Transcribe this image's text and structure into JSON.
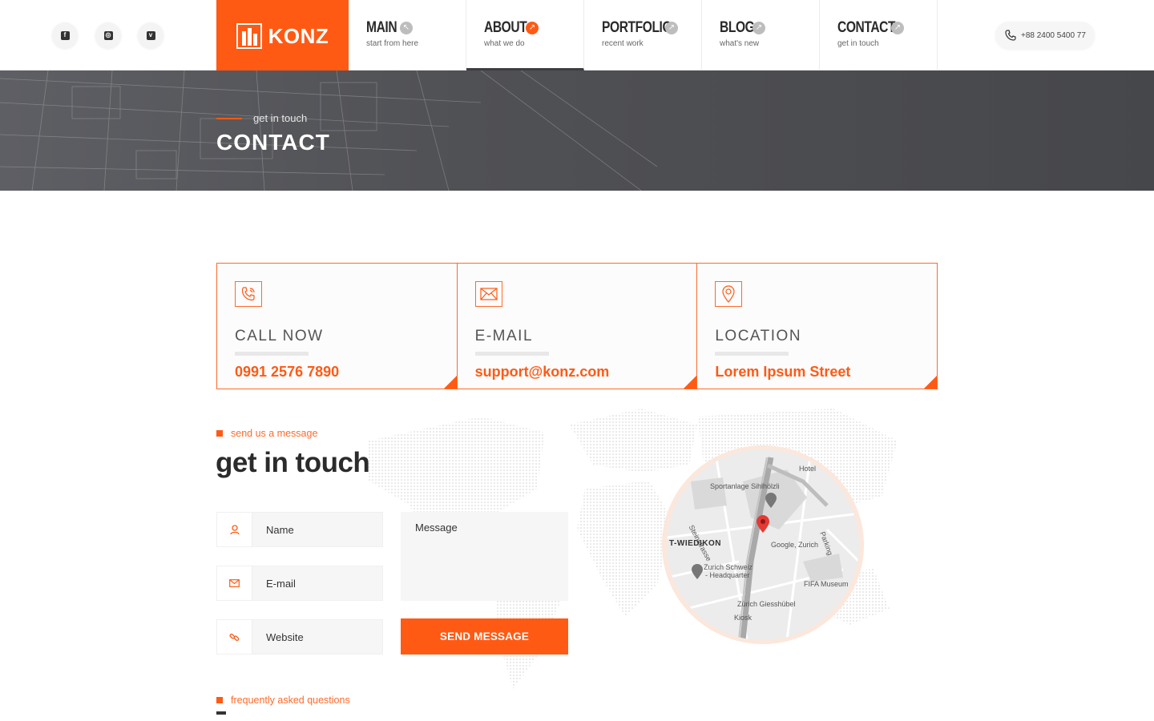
{
  "header": {
    "social": [
      {
        "icon": "facebook-icon",
        "glyph": "f"
      },
      {
        "icon": "instagram-icon",
        "glyph": "◎"
      },
      {
        "icon": "vimeo-icon",
        "glyph": "v"
      }
    ],
    "logo_text": "KONZ",
    "nav": [
      {
        "title": "MAIN",
        "sub": "start from here",
        "active": false
      },
      {
        "title": "ABOUT",
        "sub": "what we do",
        "active": true
      },
      {
        "title": "PORTFOLIO",
        "sub": "recent work",
        "active": false
      },
      {
        "title": "BLOG",
        "sub": "what's new",
        "active": false
      },
      {
        "title": "CONTACT",
        "sub": "get in touch",
        "active": false
      }
    ],
    "phone": "+88 2400 5400 77"
  },
  "hero": {
    "kicker": "get in touch",
    "title": "CONTACT"
  },
  "cards": [
    {
      "icon": "phone-call-icon",
      "label": "CALL NOW",
      "value": "0991 2576 7890"
    },
    {
      "icon": "envelope-icon",
      "label": "E-MAIL",
      "value": "support@konz.com"
    },
    {
      "icon": "location-pin-icon",
      "label": "LOCATION",
      "value": "Lorem Ipsum Street"
    }
  ],
  "form": {
    "kicker": "send us a message",
    "title": "get in touch",
    "name_placeholder": "Name",
    "email_placeholder": "E-mail",
    "website_placeholder": "Website",
    "message_placeholder": "Message",
    "send_label": "SEND MESSAGE"
  },
  "map": {
    "labels": {
      "hotel": "Hotel",
      "sportanlage": "Sportanlage Sihlhölzli",
      "steinstrasse": "Steinstrasse",
      "wiedikon": "T-WIEDIKON",
      "google": "Google, Zurich",
      "zurich_schweiz": "Zurich Schweiz",
      "headquarter": "- Headquarter",
      "fifa": "FIFA Museum",
      "giesshubel": "Zürich Giesshübel",
      "kiosk": "Kiosk",
      "parking": "Parking"
    }
  },
  "faq": {
    "kicker": "frequently asked questions"
  },
  "colors": {
    "accent": "#ff5a14",
    "dark": "#4a4b4f"
  }
}
